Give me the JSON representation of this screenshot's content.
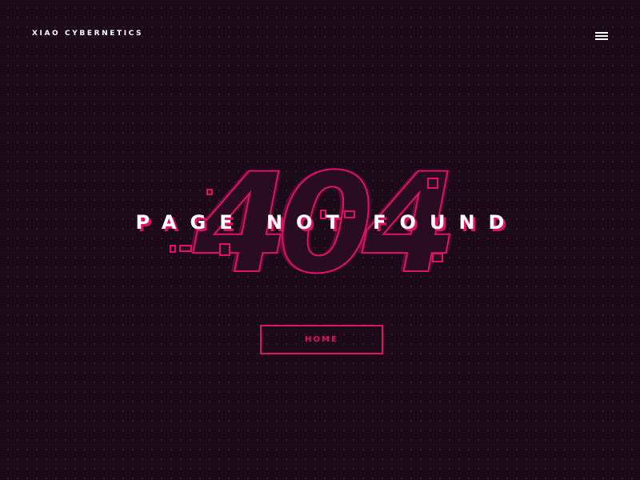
{
  "header": {
    "brand": "XIAO CYBERNETICS",
    "menu_icon": "hamburger-menu-icon"
  },
  "error": {
    "code": "404",
    "message": "PAGE NOT FOUND"
  },
  "actions": {
    "home_label": "HOME"
  },
  "colors": {
    "background": "#1e0b1a",
    "accent": "#e01264",
    "text": "#ffffff"
  }
}
